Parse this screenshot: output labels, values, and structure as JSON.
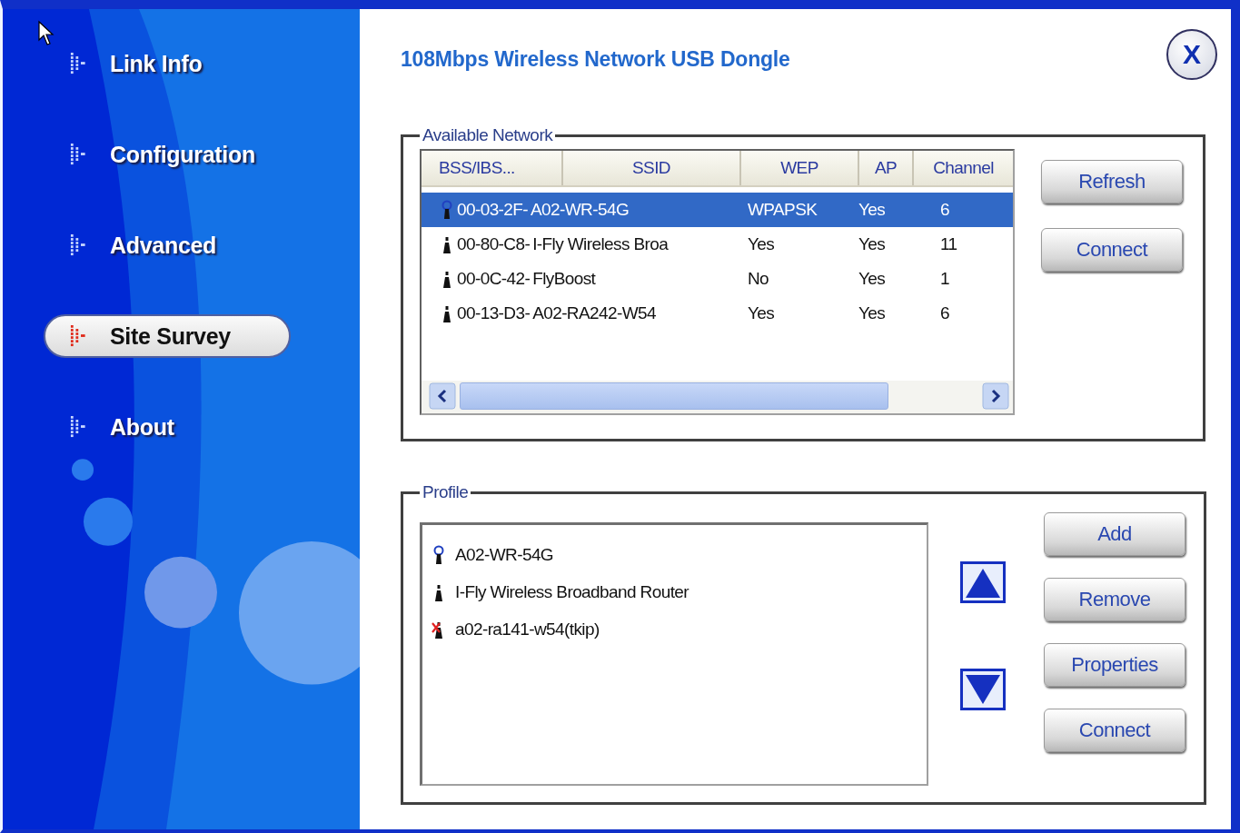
{
  "window": {
    "title": "108Mbps Wireless Network USB Dongle",
    "close_label": "X"
  },
  "sidebar": {
    "items": [
      {
        "label": "Link Info",
        "selected": false
      },
      {
        "label": "Configuration",
        "selected": false
      },
      {
        "label": "Advanced",
        "selected": false
      },
      {
        "label": "Site Survey",
        "selected": true
      },
      {
        "label": "About",
        "selected": false
      }
    ]
  },
  "available_network": {
    "title": "Available Network",
    "columns": [
      "BSS/IBS...",
      "SSID",
      "WEP",
      "AP",
      "Channel"
    ],
    "rows": [
      {
        "kind": "connected",
        "selected": true,
        "cells": [
          "00-03-2F-",
          "A02-WR-54G",
          "WPAPSK",
          "Yes",
          "6"
        ]
      },
      {
        "kind": "access_point",
        "selected": false,
        "cells": [
          "00-80-C8-",
          "I-Fly Wireless Broa",
          "Yes",
          "Yes",
          "11"
        ]
      },
      {
        "kind": "access_point",
        "selected": false,
        "cells": [
          "00-0C-42-",
          "FlyBoost",
          "No",
          "Yes",
          "1"
        ]
      },
      {
        "kind": "access_point",
        "selected": false,
        "cells": [
          "00-13-D3-",
          "A02-RA242-W54",
          "Yes",
          "Yes",
          "6"
        ]
      }
    ],
    "buttons": [
      "Refresh",
      "Connect"
    ]
  },
  "profile": {
    "title": "Profile",
    "items": [
      {
        "kind": "connected",
        "label": "A02-WR-54G"
      },
      {
        "kind": "access_point",
        "label": "I-Fly Wireless Broadband Router"
      },
      {
        "kind": "unavailable",
        "label": "a02-ra141-w54(tkip)"
      }
    ],
    "buttons": [
      "Add",
      "Remove",
      "Properties",
      "Connect"
    ]
  }
}
